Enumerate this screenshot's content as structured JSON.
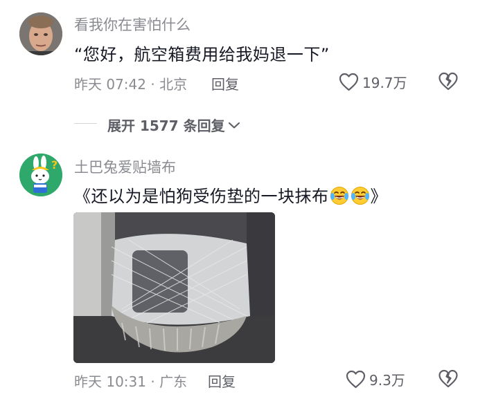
{
  "comments": [
    {
      "username": "看我你在害怕什么",
      "text": "“您好，航空箱费用给我妈退一下”",
      "time": "昨天 07:42",
      "location": "北京",
      "reply_label": "回复",
      "likes": "19.7万",
      "expand_label": "展开 1577 条回复"
    },
    {
      "username": "土巴兔爱贴墙布",
      "text_prefix": "《还以为是怕狗受伤垫的一块抹布",
      "text_suffix": "》",
      "emojis": [
        "laughing-crying-emoji",
        "laughing-crying-emoji"
      ],
      "time": "昨天 10:31",
      "location": "广东",
      "reply_label": "回复",
      "likes": "9.3万"
    }
  ],
  "colors": {
    "secondary_text": "#8a8b91",
    "primary_text": "#161823",
    "avatar2_bg": "#2ea86b"
  },
  "icons": [
    "heart-outline-icon",
    "broken-heart-icon",
    "chevron-down-icon"
  ]
}
